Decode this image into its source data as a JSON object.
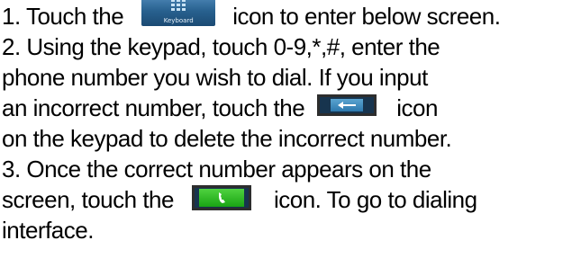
{
  "steps": [
    {
      "line1_before": "1. Touch the",
      "line1_after": "icon to enter below screen."
    },
    {
      "line1": "2. Using the keypad, touch 0-9,*,#, enter the",
      "line2": "phone number you wish to dial. If you input",
      "line3_before": "an incorrect number, touch the",
      "line3_after": "icon",
      "line4": "on the keypad to delete the incorrect number."
    },
    {
      "line1": "3. Once the correct number appears on the",
      "line2_before": "screen, touch the",
      "line2_after": "icon. To go to dialing",
      "line3": "interface."
    }
  ],
  "icons": {
    "keyboard": {
      "name": "keyboard-icon",
      "label": "Keyboard",
      "color": "#28618f"
    },
    "backspace": {
      "name": "backspace-icon",
      "color": "#2d78ad"
    },
    "call": {
      "name": "call-icon",
      "color": "#19a414"
    }
  }
}
